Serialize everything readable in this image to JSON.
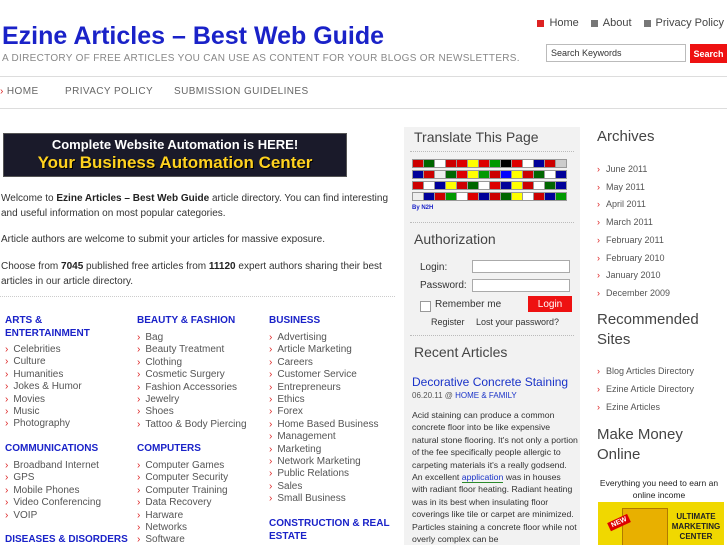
{
  "header": {
    "title": "Ezine Articles – Best Web Guide",
    "tagline": "A DIRECTORY OF FREE ARTICLES YOU CAN USE AS CONTENT FOR YOUR BLOGS OR NEWSLETTERS.",
    "top_links": [
      "Home",
      "About",
      "Privacy Policy"
    ],
    "search_placeholder": "Search Keywords",
    "search_button": "Search"
  },
  "nav": [
    "HOME",
    "PRIVACY POLICY",
    "SUBMISSION GUIDELINES"
  ],
  "banner": {
    "line1": "Complete Website Automation is HERE!",
    "line2": "Your Business Automation Center"
  },
  "intro": {
    "p1_a": "Welcome to ",
    "p1_b": "Ezine Articles – Best Web Guide",
    "p1_c": " article directory. You can find interesting and useful information on most popular categories.",
    "p2": "Article authors are welcome to submit your articles for massive exposure.",
    "p3_a": "Choose from ",
    "p3_articles": "7045",
    "p3_b": " published free articles from ",
    "p3_authors": "11120",
    "p3_c": " expert authors sharing their best articles in our article directory."
  },
  "categories": {
    "arts": {
      "title": "ARTS & ENTERTAINMENT",
      "items": [
        "Celebrities",
        "Culture",
        "Humanities",
        "Jokes & Humor",
        "Movies",
        "Music",
        "Photography"
      ]
    },
    "communications": {
      "title": "COMMUNICATIONS",
      "items": [
        "Broadband Internet",
        "GPS",
        "Mobile Phones",
        "Video Conferencing",
        "VOIP"
      ]
    },
    "diseases": {
      "title": "DISEASES & DISORDERS"
    },
    "beauty": {
      "title": "BEAUTY & FASHION",
      "items": [
        "Bag",
        "Beauty Treatment",
        "Clothing",
        "Cosmetic Surgery",
        "Fashion Accessories",
        "Jewelry",
        "Shoes",
        "Tattoo & Body Piercing"
      ]
    },
    "computers": {
      "title": "COMPUTERS",
      "items": [
        "Computer Games",
        "Computer Security",
        "Computer Training",
        "Data Recovery",
        "Harware",
        "Networks",
        "Software"
      ]
    },
    "business": {
      "title": "BUSINESS",
      "items": [
        "Advertising",
        "Article Marketing",
        "Careers",
        "Customer Service",
        "Entrepreneurs",
        "Ethics",
        "Forex",
        "Home Based Business",
        "Management",
        "Marketing",
        "Network Marketing",
        "Public Relations",
        "Sales",
        "Small Business"
      ]
    },
    "construction": {
      "title": "CONSTRUCTION & REAL ESTATE"
    }
  },
  "middle": {
    "translate_title": "Translate This Page",
    "by_label": "By N2H",
    "auth_title": "Authorization",
    "login_label": "Login:",
    "password_label": "Password:",
    "remember_label": "Remember me",
    "login_button": "Login",
    "register_link": "Register",
    "lost_password_link": "Lost your password?",
    "recent_title": "Recent Articles",
    "post": {
      "title": "Decorative Concrete Staining",
      "date": "06.20.11",
      "sep": " @ ",
      "category": "HOME & FAMILY",
      "excerpt_a": "Acid staining can produce a common concrete floor into be like expensive natural stone flooring. It's not only a portion of the fee specifically people allergic to carpeting materials it's a really godsend. An excellent ",
      "excerpt_link": "application",
      "excerpt_b": " was in houses with radiant floor heating. Radiant heating was in its best when insulating floor coverings like tile or carpet are minimized. Particles staining a concrete floor while not overly complex can be"
    }
  },
  "right": {
    "archives_title": "Archives",
    "archives": [
      "June 2011",
      "May 2011",
      "April 2011",
      "March 2011",
      "February 2011",
      "February 2010",
      "January 2010",
      "December 2009"
    ],
    "recommended_title": "Recommended Sites",
    "recommended": [
      "Blog Articles Directory",
      "Ezine Article Directory",
      "Ezine Articles"
    ],
    "money_title": "Make Money Online",
    "money_text": "Everything you need to earn an online income",
    "ad_new": "NEW",
    "ad_line1": "ULTIMATE",
    "ad_line2": "MARKETING",
    "ad_line3": "CENTER"
  },
  "colors": {
    "title_blue": "#1a22c8",
    "link_blue": "#1a33c8",
    "accent_red": "#ee1111",
    "sidebar_gray": "#f2f2f2"
  },
  "flags": [
    "#c00",
    "#060",
    "#fff",
    "#c00",
    "#d00",
    "#ff0",
    "#d00",
    "#090",
    "#000",
    "#d00",
    "#fff",
    "#009",
    "#c00",
    "#ccc",
    "#009",
    "#c00",
    "#eee",
    "#060",
    "#d00",
    "#ff0",
    "#090",
    "#c00",
    "#00f",
    "#ff0",
    "#c00",
    "#060",
    "#fff",
    "#009",
    "#c00",
    "#fff",
    "#009",
    "#ff0",
    "#c00",
    "#060",
    "#fff",
    "#d00",
    "#009",
    "#ff0",
    "#c00",
    "#fff",
    "#060",
    "#009",
    "#eee",
    "#009",
    "#c00",
    "#090",
    "#fff",
    "#d00",
    "#009",
    "#c00",
    "#060",
    "#ff0",
    "#fff",
    "#c00",
    "#009",
    "#090"
  ]
}
